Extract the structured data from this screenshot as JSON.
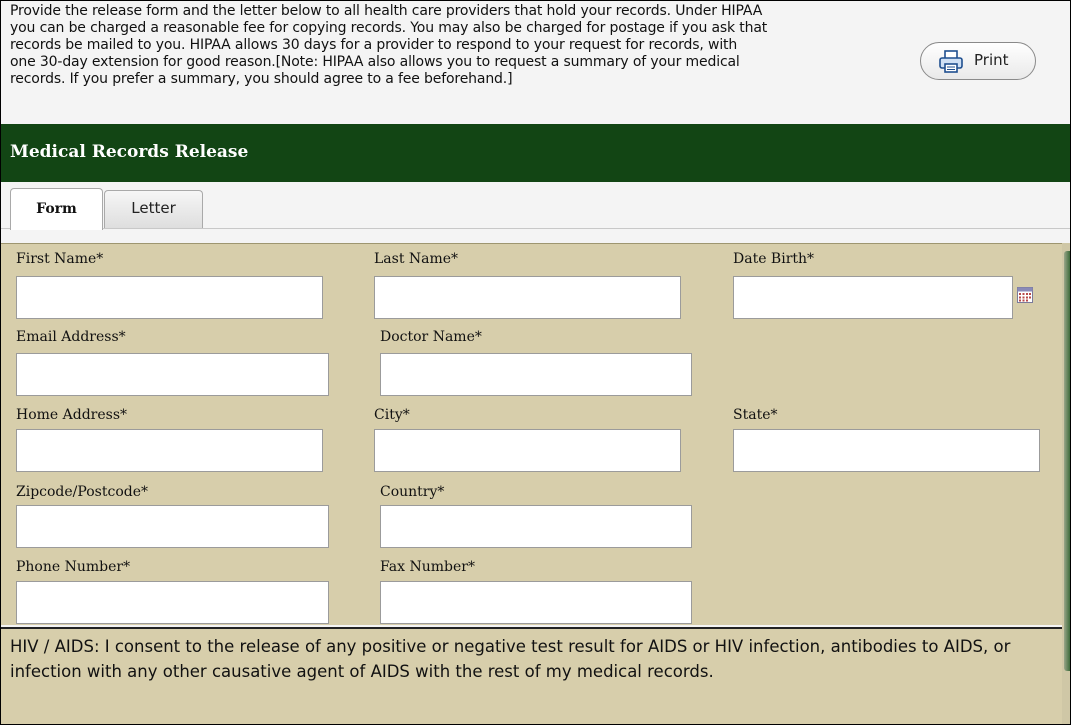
{
  "intro": {
    "text": "Provide the release form and the letter below to all health care providers that hold your records. Under HIPAA\nyou can be charged a reasonable fee for copying records. You may also be charged for postage if you ask that\nrecords be mailed to you. HIPAA allows 30 days for a provider to respond to your request for records, with\none 30-day extension for good reason.[Note: HIPAA also allows you to request a summary of your medical\nrecords. If you prefer a summary, you should agree to a fee beforehand.]",
    "print_label": "Print",
    "print_icon": "printer-icon"
  },
  "header": {
    "title": "Medical Records Release"
  },
  "tabs": [
    {
      "label": "Form",
      "active": true
    },
    {
      "label": "Letter",
      "active": false
    }
  ],
  "form": {
    "first_name": {
      "label": "First Name*",
      "value": ""
    },
    "last_name": {
      "label": "Last Name*",
      "value": ""
    },
    "date_birth": {
      "label": "Date Birth*",
      "value": "",
      "icon": "calendar-icon"
    },
    "email": {
      "label": "Email Address*",
      "value": ""
    },
    "doctor_name": {
      "label": "Doctor Name*",
      "value": ""
    },
    "home_address": {
      "label": "Home Address*",
      "value": ""
    },
    "city": {
      "label": "City*",
      "value": ""
    },
    "state": {
      "label": "State*",
      "value": ""
    },
    "zipcode": {
      "label": "Zipcode/Postcode*",
      "value": ""
    },
    "country": {
      "label": "Country*",
      "value": ""
    },
    "phone": {
      "label": "Phone Number*",
      "value": ""
    },
    "fax": {
      "label": "Fax Number*",
      "value": ""
    }
  },
  "hiv": {
    "text": "HIV / AIDS: I consent to the release of any positive or negative test result for AIDS or HIV infection, antibodies to AIDS, or infection with any other causative agent of AIDS with the rest of my medical records."
  },
  "colors": {
    "header_green": "#124514",
    "form_background": "#d7ceab"
  }
}
